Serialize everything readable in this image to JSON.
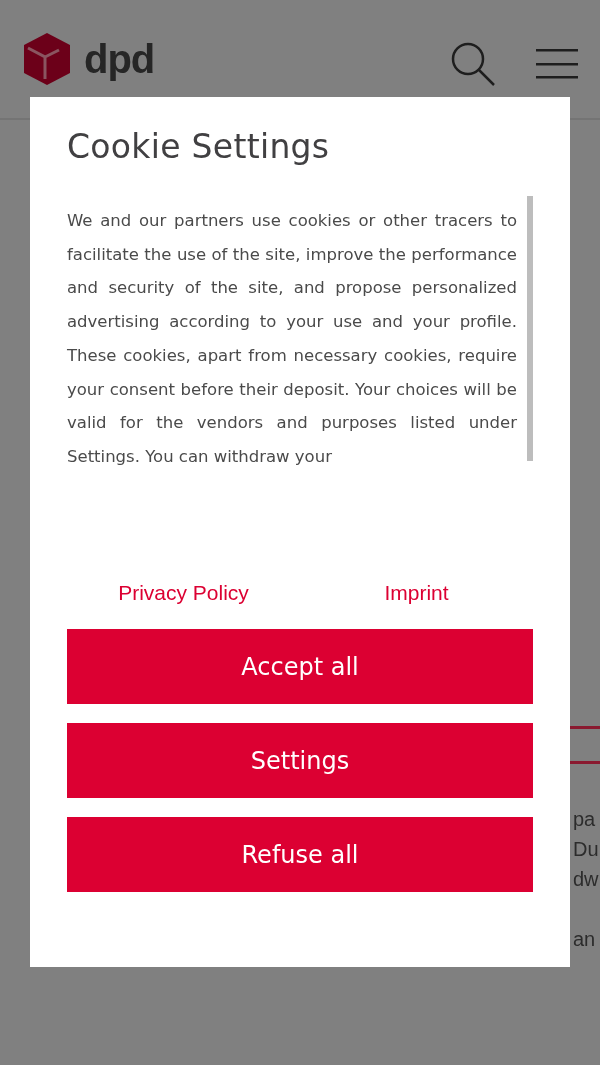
{
  "header": {
    "logo_text": "dpd"
  },
  "background_fragments": [
    "pa",
    "Du",
    "dw",
    "an"
  ],
  "dialog": {
    "title": "Cookie Settings",
    "body": "We and our partners use cookies or other tracers to facilitate the use of the site, improve the performance and security of the site, and propose personalized advertising according to your use and your profile. These cookies, apart from necessary cookies, require your consent before their deposit. Your choices will be valid for the vendors and purposes listed under Settings. You can withdraw your",
    "links": [
      "Privacy Policy",
      "Imprint"
    ],
    "buttons": [
      "Accept all",
      "Settings",
      "Refuse all"
    ]
  }
}
